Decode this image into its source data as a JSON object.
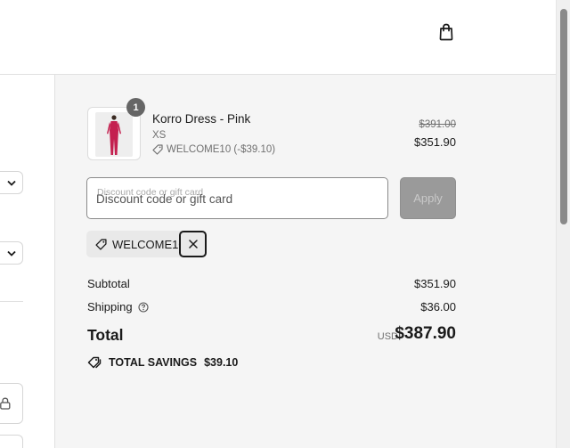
{
  "header": {
    "bag_icon": "shopping-bag-icon"
  },
  "product": {
    "quantity": "1",
    "name": "Korro Dress - Pink",
    "variant": "XS",
    "discount_applied": "WELCOME10 (-$39.10)",
    "original_price": "$391.00",
    "price": "$351.90"
  },
  "discount": {
    "floating_label": "Discount code or gift card",
    "placeholder": "Discount code or gift card",
    "apply_label": "Apply",
    "chip_code": "WELCOME10"
  },
  "totals": {
    "subtotal_label": "Subtotal",
    "subtotal_value": "$351.90",
    "shipping_label": "Shipping",
    "shipping_value": "$36.00",
    "total_label": "Total",
    "currency": "USD",
    "total_value": "$387.90"
  },
  "savings": {
    "label": "TOTAL SAVINGS",
    "amount": "$39.10"
  },
  "colors": {
    "panel_bg": "#f5f5f5",
    "apply_bg": "#9a9a9a",
    "badge_bg": "#666666",
    "dress_pink": "#c4204f"
  }
}
